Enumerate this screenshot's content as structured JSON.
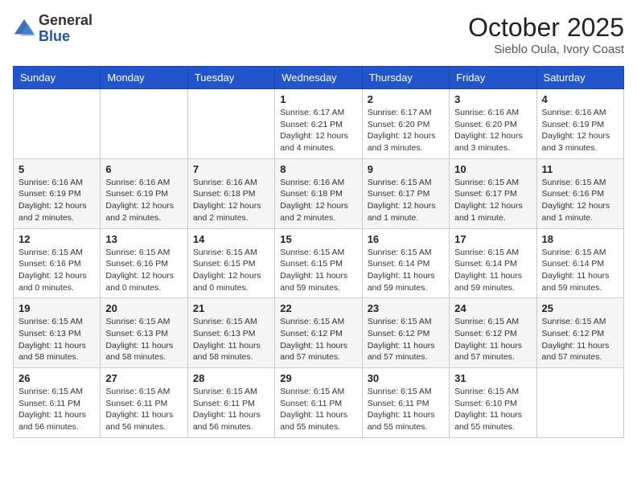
{
  "header": {
    "logo_general": "General",
    "logo_blue": "Blue",
    "month_title": "October 2025",
    "location": "Sieblo Oula, Ivory Coast"
  },
  "weekdays": [
    "Sunday",
    "Monday",
    "Tuesday",
    "Wednesday",
    "Thursday",
    "Friday",
    "Saturday"
  ],
  "weeks": [
    [
      {
        "day": "",
        "info": ""
      },
      {
        "day": "",
        "info": ""
      },
      {
        "day": "",
        "info": ""
      },
      {
        "day": "1",
        "info": "Sunrise: 6:17 AM\nSunset: 6:21 PM\nDaylight: 12 hours\nand 4 minutes."
      },
      {
        "day": "2",
        "info": "Sunrise: 6:17 AM\nSunset: 6:20 PM\nDaylight: 12 hours\nand 3 minutes."
      },
      {
        "day": "3",
        "info": "Sunrise: 6:16 AM\nSunset: 6:20 PM\nDaylight: 12 hours\nand 3 minutes."
      },
      {
        "day": "4",
        "info": "Sunrise: 6:16 AM\nSunset: 6:19 PM\nDaylight: 12 hours\nand 3 minutes."
      }
    ],
    [
      {
        "day": "5",
        "info": "Sunrise: 6:16 AM\nSunset: 6:19 PM\nDaylight: 12 hours\nand 2 minutes."
      },
      {
        "day": "6",
        "info": "Sunrise: 6:16 AM\nSunset: 6:19 PM\nDaylight: 12 hours\nand 2 minutes."
      },
      {
        "day": "7",
        "info": "Sunrise: 6:16 AM\nSunset: 6:18 PM\nDaylight: 12 hours\nand 2 minutes."
      },
      {
        "day": "8",
        "info": "Sunrise: 6:16 AM\nSunset: 6:18 PM\nDaylight: 12 hours\nand 2 minutes."
      },
      {
        "day": "9",
        "info": "Sunrise: 6:15 AM\nSunset: 6:17 PM\nDaylight: 12 hours\nand 1 minute."
      },
      {
        "day": "10",
        "info": "Sunrise: 6:15 AM\nSunset: 6:17 PM\nDaylight: 12 hours\nand 1 minute."
      },
      {
        "day": "11",
        "info": "Sunrise: 6:15 AM\nSunset: 6:16 PM\nDaylight: 12 hours\nand 1 minute."
      }
    ],
    [
      {
        "day": "12",
        "info": "Sunrise: 6:15 AM\nSunset: 6:16 PM\nDaylight: 12 hours\nand 0 minutes."
      },
      {
        "day": "13",
        "info": "Sunrise: 6:15 AM\nSunset: 6:16 PM\nDaylight: 12 hours\nand 0 minutes."
      },
      {
        "day": "14",
        "info": "Sunrise: 6:15 AM\nSunset: 6:15 PM\nDaylight: 12 hours\nand 0 minutes."
      },
      {
        "day": "15",
        "info": "Sunrise: 6:15 AM\nSunset: 6:15 PM\nDaylight: 11 hours\nand 59 minutes."
      },
      {
        "day": "16",
        "info": "Sunrise: 6:15 AM\nSunset: 6:14 PM\nDaylight: 11 hours\nand 59 minutes."
      },
      {
        "day": "17",
        "info": "Sunrise: 6:15 AM\nSunset: 6:14 PM\nDaylight: 11 hours\nand 59 minutes."
      },
      {
        "day": "18",
        "info": "Sunrise: 6:15 AM\nSunset: 6:14 PM\nDaylight: 11 hours\nand 59 minutes."
      }
    ],
    [
      {
        "day": "19",
        "info": "Sunrise: 6:15 AM\nSunset: 6:13 PM\nDaylight: 11 hours\nand 58 minutes."
      },
      {
        "day": "20",
        "info": "Sunrise: 6:15 AM\nSunset: 6:13 PM\nDaylight: 11 hours\nand 58 minutes."
      },
      {
        "day": "21",
        "info": "Sunrise: 6:15 AM\nSunset: 6:13 PM\nDaylight: 11 hours\nand 58 minutes."
      },
      {
        "day": "22",
        "info": "Sunrise: 6:15 AM\nSunset: 6:12 PM\nDaylight: 11 hours\nand 57 minutes."
      },
      {
        "day": "23",
        "info": "Sunrise: 6:15 AM\nSunset: 6:12 PM\nDaylight: 11 hours\nand 57 minutes."
      },
      {
        "day": "24",
        "info": "Sunrise: 6:15 AM\nSunset: 6:12 PM\nDaylight: 11 hours\nand 57 minutes."
      },
      {
        "day": "25",
        "info": "Sunrise: 6:15 AM\nSunset: 6:12 PM\nDaylight: 11 hours\nand 57 minutes."
      }
    ],
    [
      {
        "day": "26",
        "info": "Sunrise: 6:15 AM\nSunset: 6:11 PM\nDaylight: 11 hours\nand 56 minutes."
      },
      {
        "day": "27",
        "info": "Sunrise: 6:15 AM\nSunset: 6:11 PM\nDaylight: 11 hours\nand 56 minutes."
      },
      {
        "day": "28",
        "info": "Sunrise: 6:15 AM\nSunset: 6:11 PM\nDaylight: 11 hours\nand 56 minutes."
      },
      {
        "day": "29",
        "info": "Sunrise: 6:15 AM\nSunset: 6:11 PM\nDaylight: 11 hours\nand 55 minutes."
      },
      {
        "day": "30",
        "info": "Sunrise: 6:15 AM\nSunset: 6:11 PM\nDaylight: 11 hours\nand 55 minutes."
      },
      {
        "day": "31",
        "info": "Sunrise: 6:15 AM\nSunset: 6:10 PM\nDaylight: 11 hours\nand 55 minutes."
      },
      {
        "day": "",
        "info": ""
      }
    ]
  ]
}
